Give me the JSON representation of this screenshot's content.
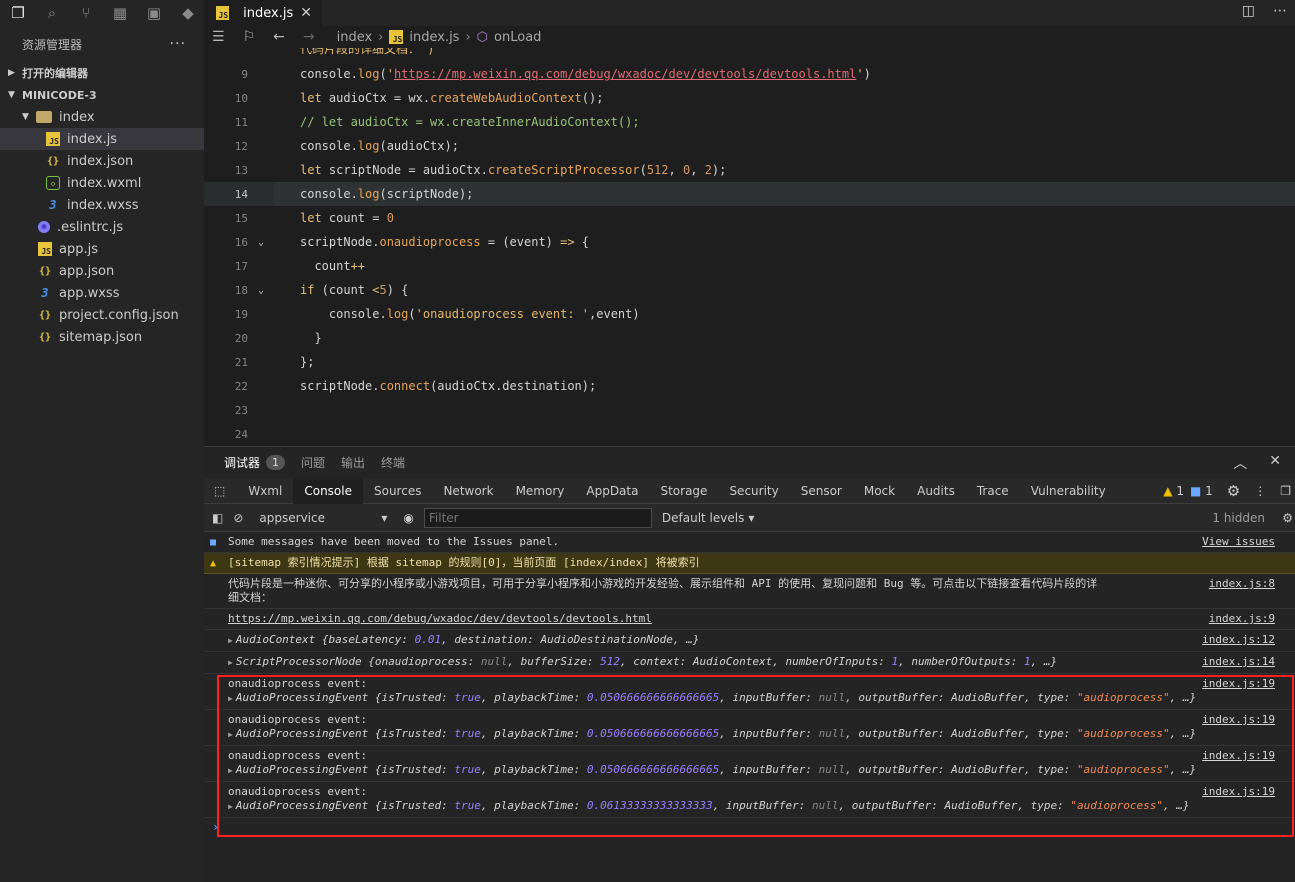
{
  "tab": {
    "file": "index.js"
  },
  "sidebar": {
    "title": "资源管理器",
    "more": "···",
    "open_editors": "打开的编辑器",
    "project": "MINICODE-3",
    "folder": "index",
    "items": [
      {
        "name": "index.js",
        "type": "js",
        "indent": 2
      },
      {
        "name": "index.json",
        "type": "json",
        "indent": 2
      },
      {
        "name": "index.wxml",
        "type": "wxml",
        "indent": 2
      },
      {
        "name": "index.wxss",
        "type": "wxss",
        "indent": 2
      },
      {
        "name": ".eslintrc.js",
        "type": "eslint",
        "indent": 1
      },
      {
        "name": "app.js",
        "type": "js",
        "indent": 1
      },
      {
        "name": "app.json",
        "type": "json",
        "indent": 1
      },
      {
        "name": "app.wxss",
        "type": "wxss",
        "indent": 1
      },
      {
        "name": "project.config.json",
        "type": "json",
        "indent": 1
      },
      {
        "name": "sitemap.json",
        "type": "json",
        "indent": 1
      }
    ]
  },
  "breadcrumb": {
    "folder": "index",
    "file": "index.js",
    "symbol": "onLoad"
  },
  "editor": {
    "current_line": 14,
    "lines": [
      {
        "n": 9,
        "html": "console.log(<s>'https://mp.weixin.qq.com/debug/wxadoc/dev/devtools/devtools.html'</s>)"
      },
      {
        "n": 10,
        "html": "let audioCtx = wx.createWebAudioContext();"
      },
      {
        "n": 11,
        "html": "// let audioCtx = wx.createInnerAudioContext();"
      },
      {
        "n": 12,
        "html": "console.log(audioCtx);"
      },
      {
        "n": 13,
        "html": "let scriptNode = audioCtx.createScriptProcessor(512, 0, 2);"
      },
      {
        "n": 14,
        "html": "console.log(scriptNode);"
      },
      {
        "n": 15,
        "html": "let count = 0"
      },
      {
        "n": 16,
        "html": "scriptNode.onaudioprocess = (event) => {"
      },
      {
        "n": 17,
        "html": "  count++"
      },
      {
        "n": 18,
        "html": "  if (count < 5) {"
      },
      {
        "n": 19,
        "html": "    console.log('onaudioprocess event: ',event)"
      },
      {
        "n": 20,
        "html": "  }"
      },
      {
        "n": 21,
        "html": "};"
      },
      {
        "n": 22,
        "html": "scriptNode.connect(audioCtx.destination);"
      },
      {
        "n": 23,
        "html": ""
      },
      {
        "n": 24,
        "html": ""
      }
    ]
  },
  "devtools": {
    "top_tabs": [
      "调试器",
      "问题",
      "输出",
      "终端"
    ],
    "debugger_badge": "1",
    "tabs": [
      "Wxml",
      "Console",
      "Sources",
      "Network",
      "Memory",
      "AppData",
      "Storage",
      "Security",
      "Sensor",
      "Mock",
      "Audits",
      "Trace",
      "Vulnerability"
    ],
    "active_tab": "Console",
    "warn_count": "1",
    "info_count": "1",
    "context": "appservice",
    "filter_placeholder": "Filter",
    "levels": "Default levels",
    "hidden": "1 hidden",
    "issues_msg": "Some messages have been moved to the Issues panel.",
    "view_issues": "View issues",
    "sitemap_warn": "[sitemap 索引情况提示] 根据 sitemap 的规则[0]，当前页面 [index/index] 将被索引",
    "intro_line1": "代码片段是一种迷你、可分享的小程序或小游戏项目，可用于分享小程序和小游戏的开发经验、展示组件和 API 的使用、复现问题和 Bug 等。可点击以下链接查看代码片段的详",
    "intro_line2": "细文档：",
    "intro_src": "index.js:8",
    "url": "https://mp.weixin.qq.com/debug/wxadoc/dev/devtools/devtools.html",
    "url_src": "index.js:9",
    "audio_ctx_src": "index.js:12",
    "script_node_src": "index.js:14",
    "event_label": "onaudioprocess event:",
    "event_src": "index.js:19",
    "events": [
      {
        "playbackTime": "0.050666666666666665"
      },
      {
        "playbackTime": "0.050666666666666665"
      },
      {
        "playbackTime": "0.050666666666666665"
      },
      {
        "playbackTime": "0.06133333333333333"
      }
    ]
  }
}
